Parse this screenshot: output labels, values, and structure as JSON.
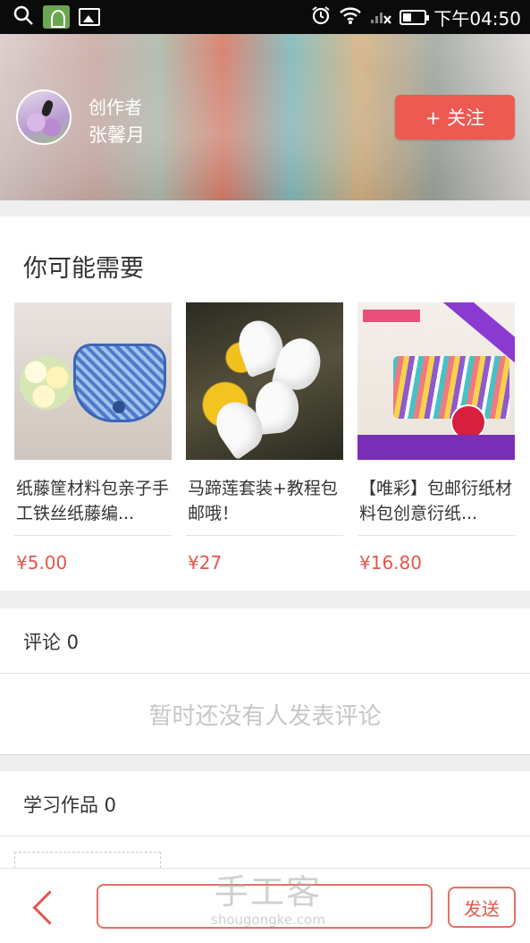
{
  "status_bar": {
    "time": "下午04:50",
    "left_icons": [
      "search-icon",
      "app-icon",
      "image-icon"
    ],
    "right_icons": [
      "alarm-icon",
      "wifi-icon",
      "signal-icon",
      "battery-icon"
    ]
  },
  "header": {
    "role_label": "创作者",
    "author_name": "张馨月",
    "follow_label": "+ 关注",
    "accent_color": "#ec5a52"
  },
  "recommend": {
    "title": "你可能需要",
    "products": [
      {
        "name": "纸藤筐材料包亲子手工铁丝纸藤编...",
        "price": "¥5.00"
      },
      {
        "name": "马蹄莲套装+教程包邮哦！",
        "price": "¥27"
      },
      {
        "name": "【唯彩】包邮衍纸材料包创意衍纸...",
        "price": "¥16.80"
      }
    ]
  },
  "comments": {
    "title": "评论 0",
    "empty_message": "暂时还没有人发表评论"
  },
  "works": {
    "title": "学习作品 0"
  },
  "bottom_bar": {
    "input_value": "",
    "send_label": "发送",
    "watermark_cn": "手工客",
    "watermark_en": "shougongke.com"
  }
}
